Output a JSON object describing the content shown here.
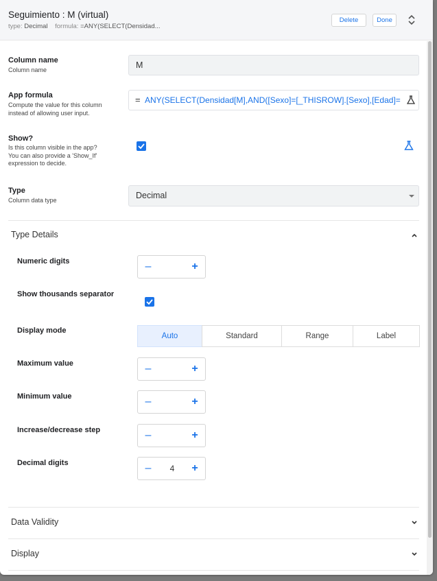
{
  "header": {
    "title": "Seguimiento : M (virtual)",
    "type_key": "type:",
    "type_value": "Decimal",
    "formula_key": "formula:",
    "formula_value": "=ANY(SELECT(Densidad...",
    "delete_label": "Delete",
    "done_label": "Done"
  },
  "fields": {
    "column_name": {
      "label": "Column name",
      "desc": "Column name",
      "value": "M"
    },
    "app_formula": {
      "label": "App formula",
      "desc": [
        "Compute the value for this column",
        "instead of allowing user input."
      ],
      "eq": "=",
      "value": "ANY(SELECT(Densidad[M],AND([Sexo]=[_THISROW].[Sexo],[Edad]="
    },
    "show": {
      "label": "Show?",
      "desc": [
        "Is this column visible in the app?",
        "You can also provide a 'Show_If'",
        "expression to decide."
      ],
      "checked": true
    },
    "type": {
      "label": "Type",
      "desc": "Column data type",
      "value": "Decimal"
    }
  },
  "type_details": {
    "title": "Type Details",
    "numeric_digits": {
      "label": "Numeric digits",
      "value": ""
    },
    "thousands_separator": {
      "label": "Show thousands separator",
      "checked": true
    },
    "display_mode": {
      "label": "Display mode",
      "options": [
        "Auto",
        "Standard",
        "Range",
        "Label"
      ],
      "selected": "Auto"
    },
    "maximum_value": {
      "label": "Maximum value",
      "value": ""
    },
    "minimum_value": {
      "label": "Minimum value",
      "value": ""
    },
    "step": {
      "label": "Increase/decrease step",
      "value": ""
    },
    "decimal_digits": {
      "label": "Decimal digits",
      "value": "4"
    }
  },
  "sections": {
    "data_validity": "Data Validity",
    "display": "Display"
  },
  "stepper": {
    "minus": "–",
    "plus": "+"
  },
  "colors": {
    "accent": "#1a73e8",
    "header_bg": "#f5f6f8",
    "field_bg": "#f1f3f4"
  }
}
